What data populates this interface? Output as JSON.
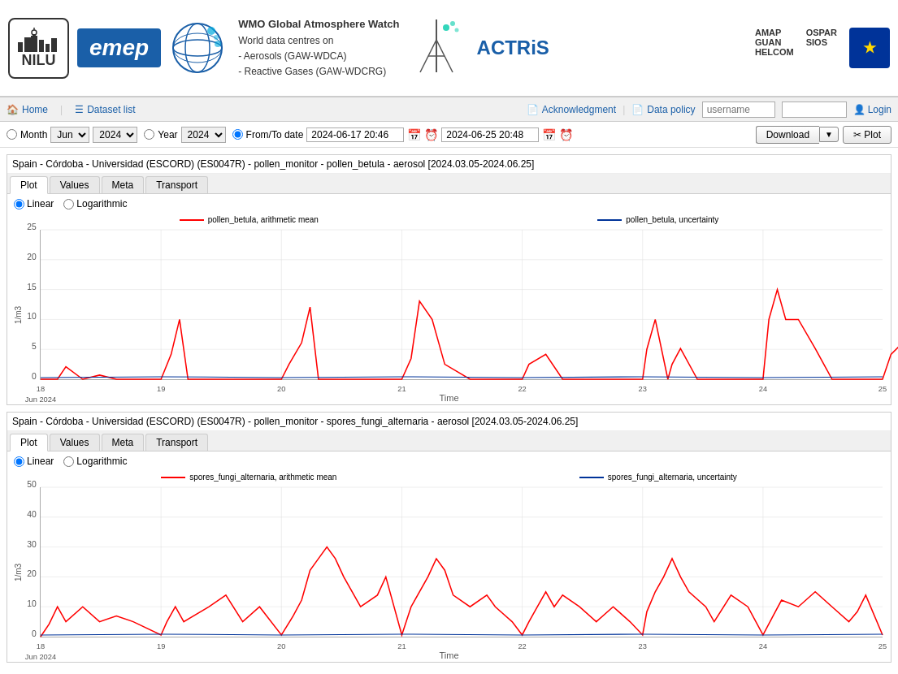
{
  "header": {
    "nilu_label": "NILU",
    "emep_label": "emep",
    "wmo_title": "WMO Global Atmosphere Watch",
    "wmo_sub1": "World data centres on",
    "wmo_sub2": "- Aerosols (GAW-WDCA)",
    "wmo_sub3": "- Reactive Gases (GAW-WDCRG)",
    "actris_label": "ACTRiS",
    "partner1": "AMAP",
    "partner2": "GUAN",
    "partner3": "HELCOM",
    "partner4": "OSPAR",
    "partner5": "SIOS"
  },
  "nav": {
    "home_label": "Home",
    "dataset_list_label": "Dataset list",
    "acknowledgment_label": "Acknowledgment",
    "data_policy_label": "Data policy",
    "username_placeholder": "username",
    "login_label": "Login"
  },
  "controls": {
    "month_label": "Month",
    "month_value": "Jun",
    "year1_value": "2024",
    "year_label": "Year",
    "year2_value": "2024",
    "from_to_label": "From/To date",
    "from_date": "2024-06-17 20:46",
    "to_date": "2024-06-25 20:48",
    "download_label": "Download",
    "plot_label": "✂ Plot"
  },
  "chart1": {
    "title": "Spain - Córdoba - Universidad (ESCORD) (ES0047R) - pollen_monitor - pollen_betula - aerosol [2024.03.05-2024.06.25]",
    "tabs": [
      "Plot",
      "Values",
      "Meta",
      "Transport"
    ],
    "active_tab": "Plot",
    "scale_linear": "Linear",
    "scale_log": "Logarithmic",
    "legend_mean": "pollen_betula, arithmetic mean",
    "legend_uncertainty": "pollen_betula, uncertainty",
    "y_label": "1/m3",
    "x_label": "Time",
    "y_ticks": [
      "0",
      "5",
      "10",
      "15",
      "20",
      "25"
    ],
    "x_ticks": [
      "18\nJun 2024",
      "19",
      "20",
      "21",
      "22",
      "23",
      "24",
      "25"
    ]
  },
  "chart2": {
    "title": "Spain - Córdoba - Universidad (ESCORD) (ES0047R) - pollen_monitor - spores_fungi_alternaria - aerosol [2024.03.05-2024.06.25]",
    "tabs": [
      "Plot",
      "Values",
      "Meta",
      "Transport"
    ],
    "active_tab": "Plot",
    "scale_linear": "Linear",
    "scale_log": "Logarithmic",
    "legend_mean": "spores_fungi_alternaria, arithmetic mean",
    "legend_uncertainty": "spores_fungi_alternaria, uncertainty",
    "y_label": "1/m3",
    "x_label": "Time",
    "y_ticks": [
      "0",
      "10",
      "20",
      "30",
      "40",
      "50"
    ],
    "x_ticks": [
      "18\nJun 2024",
      "19",
      "20",
      "21",
      "22",
      "23",
      "24",
      "25"
    ]
  }
}
